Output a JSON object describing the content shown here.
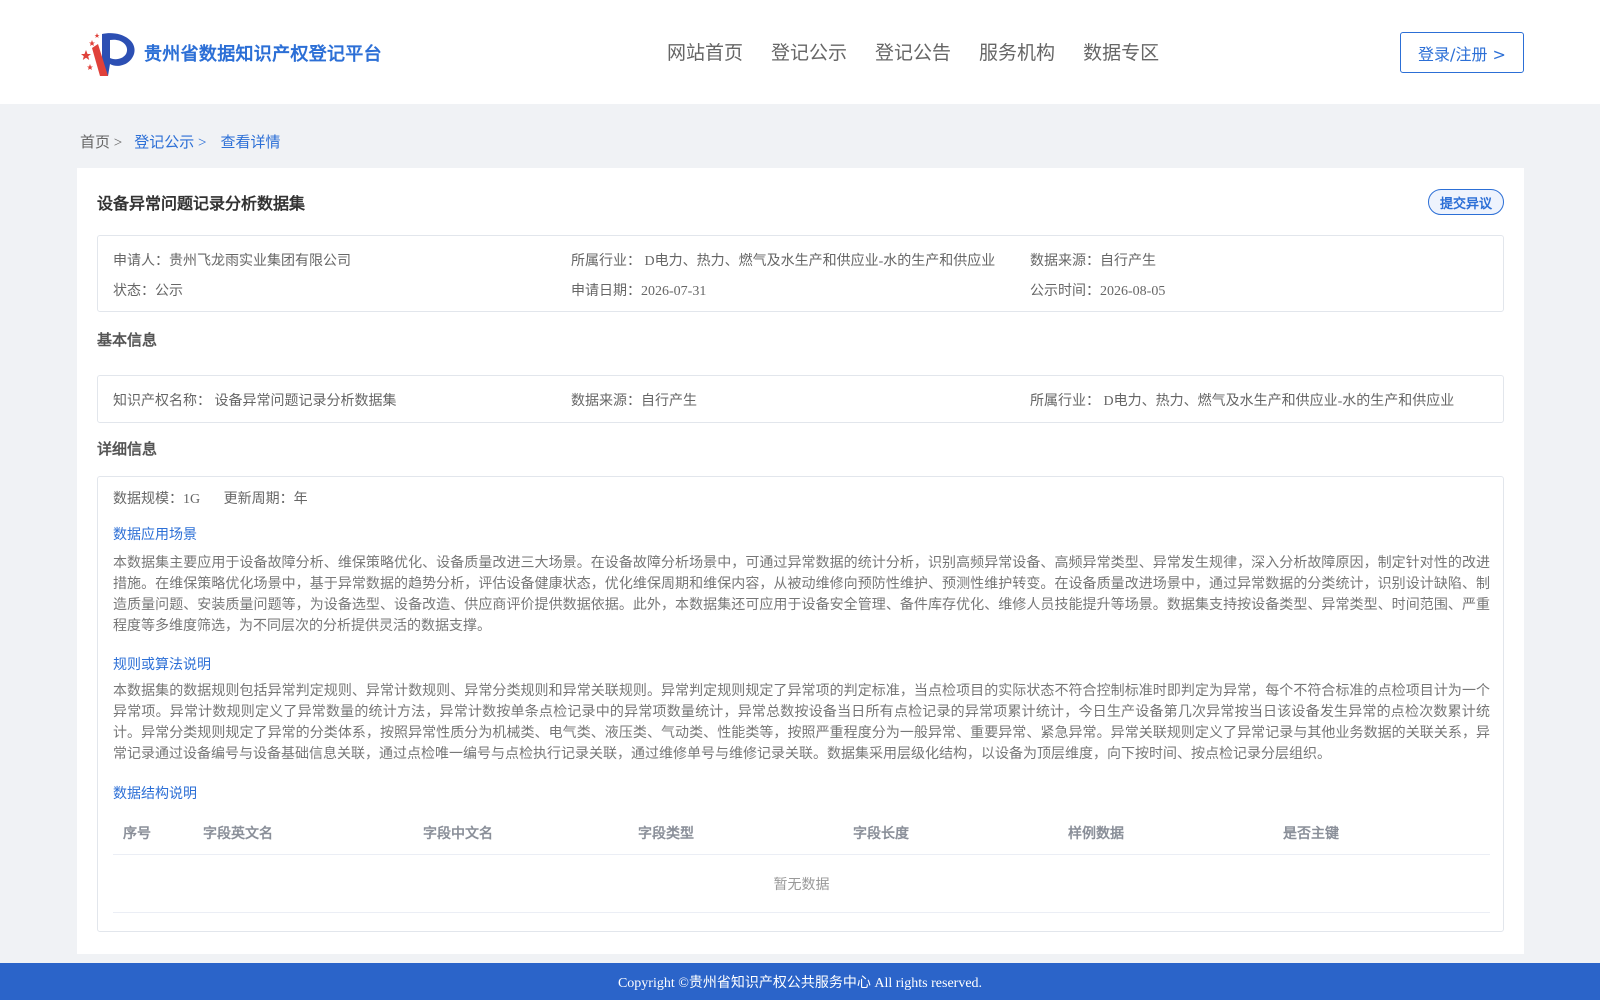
{
  "header": {
    "site_title": "贵州省数据知识产权登记平台",
    "logo_icon": "logo-icon",
    "nav": [
      {
        "label": "网站首页"
      },
      {
        "label": "登记公示"
      },
      {
        "label": "登记公告"
      },
      {
        "label": "服务机构"
      },
      {
        "label": "数据专区"
      }
    ],
    "login_label": "登录/注册 >"
  },
  "breadcrumb": {
    "home": "首页 >",
    "parent": "登记公示 >",
    "current": "查看详情"
  },
  "detail": {
    "title": "设备异常问题记录分析数据集",
    "objection_label": "提交异议",
    "summary": {
      "applicant": "申请人：贵州飞龙雨实业集团有限公司",
      "industry": "所属行业： D电力、热力、燃气及水生产和供应业-水的生产和供应业",
      "source": "数据来源：自行产生",
      "status": "状态：公示",
      "apply_date": "申请日期：2026-07-31",
      "publish_date": "公示时间：2026-08-05"
    },
    "basic_section_title": "基本信息",
    "basic": {
      "ip_name": "知识产权名称： 设备异常问题记录分析数据集",
      "source": "数据来源：自行产生",
      "industry": "所属行业： D电力、热力、燃气及水生产和供应业-水的生产和供应业"
    },
    "detail_section_title": "详细信息",
    "scale": "数据规模：1G",
    "update_cycle": "更新周期：年",
    "scenario_title": "数据应用场景",
    "scenario_text": "本数据集主要应用于设备故障分析、维保策略优化、设备质量改进三大场景。在设备故障分析场景中，可通过异常数据的统计分析，识别高频异常设备、高频异常类型、异常发生规律，深入分析故障原因，制定针对性的改进措施。在维保策略优化场景中，基于异常数据的趋势分析，评估设备健康状态，优化维保周期和维保内容，从被动维修向预防性维护、预测性维护转变。在设备质量改进场景中，通过异常数据的分类统计，识别设计缺陷、制造质量问题、安装质量问题等，为设备选型、设备改造、供应商评价提供数据依据。此外，本数据集还可应用于设备安全管理、备件库存优化、维修人员技能提升等场景。数据集支持按设备类型、异常类型、时间范围、严重程度等多维度筛选，为不同层次的分析提供灵活的数据支撑。",
    "rules_title": "规则或算法说明",
    "rules_text": "本数据集的数据规则包括异常判定规则、异常计数规则、异常分类规则和异常关联规则。异常判定规则规定了异常项的判定标准，当点检项目的实际状态不符合控制标准时即判定为异常，每个不符合标准的点检项目计为一个异常项。异常计数规则定义了异常数量的统计方法，异常计数按单条点检记录中的异常项数量统计，异常总数按设备当日所有点检记录的异常项累计统计，今日生产设备第几次异常按当日该设备发生异常的点检次数累计统计。异常分类规则规定了异常的分类体系，按照异常性质分为机械类、电气类、液压类、气动类、性能类等，按照严重程度分为一般异常、重要异常、紧急异常。异常关联规则定义了异常记录与其他业务数据的关联关系，异常记录通过设备编号与设备基础信息关联，通过点检唯一编号与点检执行记录关联，通过维修单号与维修记录关联。数据集采用层级化结构，以设备为顶层维度，向下按时间、按点检记录分层组织。",
    "structure_title": "数据结构说明",
    "table": {
      "columns": [
        "序号",
        "字段英文名",
        "字段中文名",
        "字段类型",
        "字段长度",
        "样例数据",
        "是否主键"
      ],
      "empty_text": "暂无数据"
    }
  },
  "footer": {
    "copyright": "Copyright ©贵州省知识产权公共服务中心 All rights reserved."
  },
  "colors": {
    "accent": "#2c6fd6",
    "footer_bg": "#2b64c9",
    "page_bg": "#f0f2f5"
  }
}
